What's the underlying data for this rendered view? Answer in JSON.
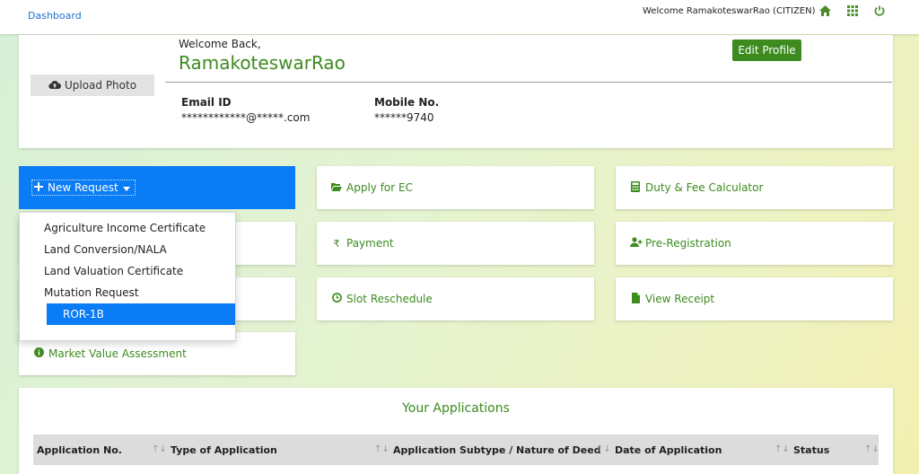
{
  "topbar": {
    "brand": "Dashboard",
    "welcome": "Welcome  RamakoteswarRao (CITIZEN)"
  },
  "profile": {
    "upload_label": "Upload Photo",
    "welcome_back": "Welcome Back,",
    "username": "RamakoteswarRao",
    "edit_label": "Edit Profile",
    "email_label": "Email ID",
    "email_value": "************@*****.com",
    "mobile_label": "Mobile No.",
    "mobile_value": "******9740"
  },
  "new_request": {
    "label": "New Request",
    "options": [
      "Agriculture Income Certificate",
      "Land Conversion/NALA",
      "Land Valuation Certificate",
      "Mutation Request",
      "ROR-1B"
    ],
    "selected": "ROR-1B"
  },
  "tiles": {
    "apply_ec": "Apply for EC",
    "duty_fee": "Duty & Fee Calculator",
    "payment": "Payment",
    "pre_registration": "Pre-Registration",
    "slot_reschedule": "Slot Reschedule",
    "view_receipt": "View Receipt",
    "market_value": "Market Value Assessment"
  },
  "applications": {
    "title": "Your Applications",
    "columns": [
      "Application No.",
      "Type of Application",
      "Application Subtype / Nature of Deed",
      "Date of Application",
      "Status"
    ],
    "sort_glyph": "↑↓"
  },
  "colors": {
    "accent_green": "#3d8b1f",
    "primary_blue": "#0a7cf5",
    "link_blue": "#1a73c9"
  }
}
